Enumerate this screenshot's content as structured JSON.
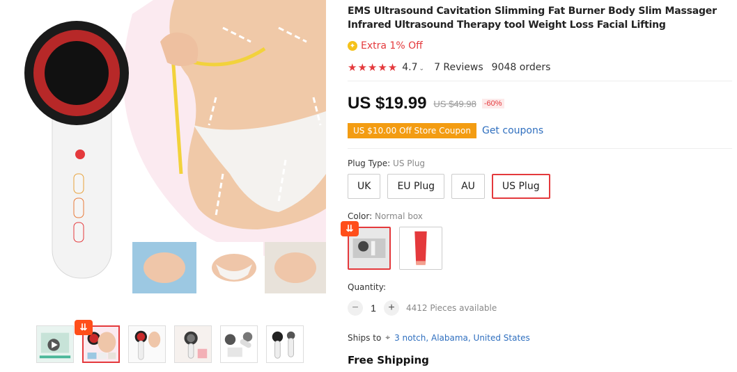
{
  "product": {
    "title": "EMS Ultrasound Cavitation Slimming Fat Burner Body Slim Massager Infrared Ultrasound Therapy tool Weight Loss Facial Lifting",
    "extra_offer": "Extra 1% Off",
    "stars": "★★★★★",
    "rating": "4.7",
    "reviews": "7 Reviews",
    "orders": "9048 orders"
  },
  "price": {
    "current": "US $19.99",
    "original": "US $49.98",
    "discount": "-60%"
  },
  "coupon": {
    "label": "US $10.00 Off Store Coupon",
    "link": "Get coupons"
  },
  "plug": {
    "label": "Plug Type: ",
    "selected": "US Plug",
    "options": [
      "UK",
      "EU Plug",
      "AU",
      "US Plug"
    ]
  },
  "color": {
    "label": "Color: ",
    "selected": "Normal box"
  },
  "quantity": {
    "label": "Quantity:",
    "value": "1",
    "minus": "−",
    "plus": "+",
    "available": "4412 Pieces available"
  },
  "shipping": {
    "label": "Ships to",
    "location": "3 notch, Alabama, United States",
    "method": "Free Shipping"
  },
  "icons": {
    "star": "star-icon",
    "location": "location-pin-icon",
    "download_badge": "download-badge-icon",
    "caret": "chevron-down-icon",
    "play": "play-icon"
  },
  "colors": {
    "accent": "#e4393c",
    "link": "#2f6fbf",
    "coupon": "#f39c12",
    "badge": "#ff4e1a"
  }
}
